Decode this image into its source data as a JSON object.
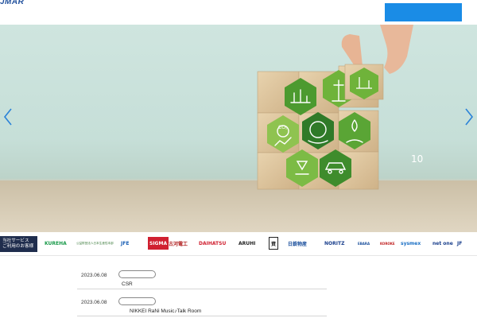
{
  "header": {
    "logo_text": "JMAR",
    "cta_label": ""
  },
  "hero": {
    "slide_counter": "10",
    "prev_label": "‹",
    "next_label": "›"
  },
  "clients": {
    "tab_label_line1": "当社サービス",
    "tab_label_line2": "ご利用のお客様",
    "logos": [
      {
        "name": "KUREHA",
        "text": "KUREHA",
        "color": "#1a9a4a"
      },
      {
        "name": "jp-foundation",
        "text": "公益財団法人日本生産性本部",
        "color": "#3a7a3a"
      },
      {
        "name": "jfe",
        "text": "JFE",
        "color": "#1a5fb4"
      },
      {
        "name": "sumitomo",
        "text": "SIGMA",
        "color": "#ffffff"
      },
      {
        "name": "furukawa",
        "text": "古河電工",
        "color": "#b02020"
      },
      {
        "name": "daihatsu",
        "text": "DAIHATSU",
        "color": "#d02030"
      },
      {
        "name": "aruhi",
        "text": "ARUHI",
        "color": "#222222"
      },
      {
        "name": "shiseido-seal",
        "text": "資",
        "color": "#222222"
      },
      {
        "name": "nippon-steel",
        "text": "日鉄物産",
        "color": "#1a4f9c"
      },
      {
        "name": "noritz",
        "text": "NORITZ",
        "color": "#1a3f8c"
      },
      {
        "name": "ebara",
        "text": "EBARA",
        "color": "#1a4f9c"
      },
      {
        "name": "koroke",
        "text": "KOROKE",
        "color": "#c02020"
      },
      {
        "name": "sysmex",
        "text": "sysmex",
        "color": "#1a6fc4"
      },
      {
        "name": "netone",
        "text": "net one",
        "color": "#1a3f8c"
      },
      {
        "name": "jf",
        "text": "JF",
        "color": "#1a3f8c"
      }
    ]
  },
  "news": [
    {
      "date": "2023.06.08",
      "title": "CSR"
    },
    {
      "date": "2023.06.08",
      "title": "NIKKEI  RaNi Music♪Talk Room"
    }
  ],
  "colors": {
    "brand": "#1f4f9c",
    "accent": "#1a8ce6",
    "dark_tab": "#1f2d4d"
  }
}
